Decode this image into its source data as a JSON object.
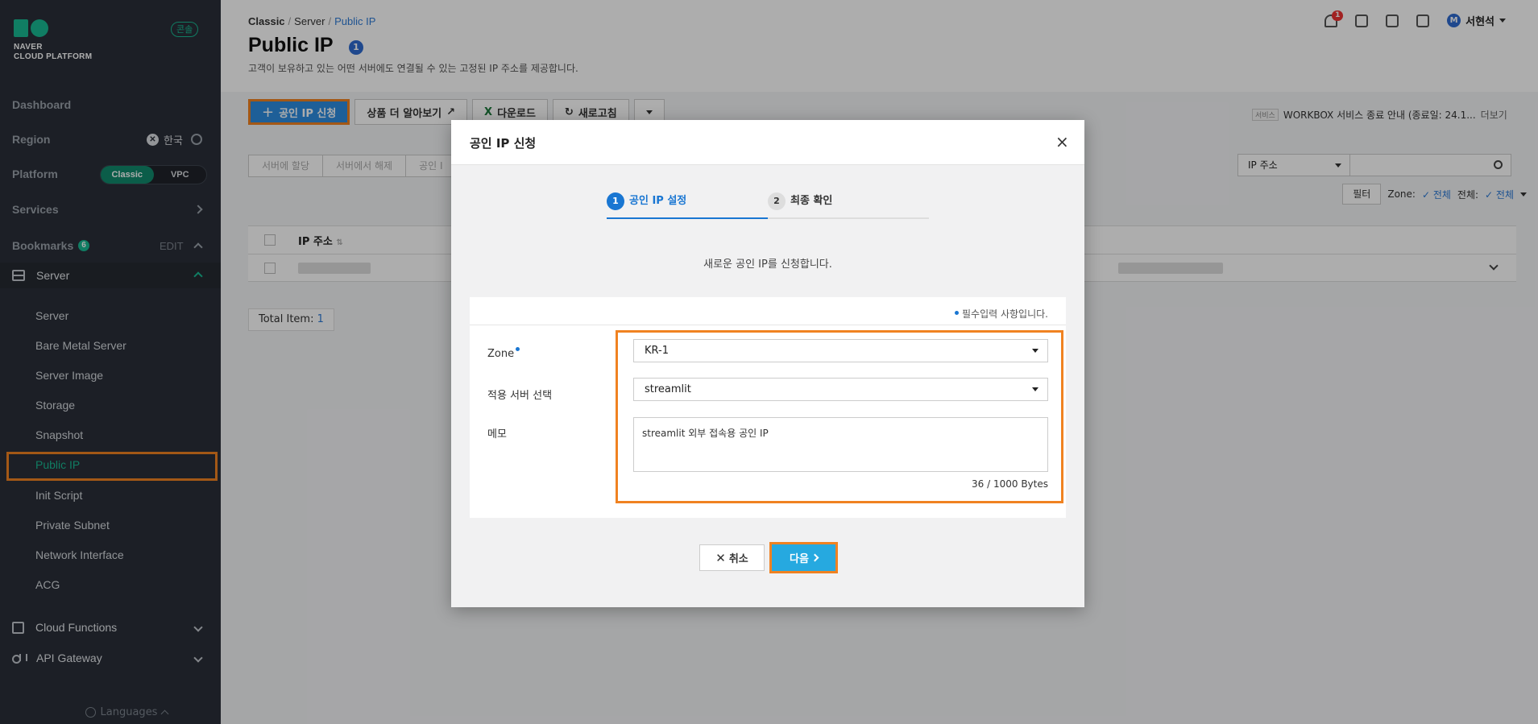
{
  "sidebar": {
    "logo_line1": "NAVER",
    "logo_line2": "CLOUD PLATFORM",
    "console_badge": "콘솔",
    "dashboard": "Dashboard",
    "region_label": "Region",
    "region_value": "한국",
    "platform_label": "Platform",
    "platform_options": [
      "Classic",
      "VPC"
    ],
    "platform_selected": "Classic",
    "services_label": "Services",
    "bookmarks_label": "Bookmarks",
    "bookmarks_count": "6",
    "bookmarks_edit": "EDIT",
    "server_group": "Server",
    "server_items": [
      "Server",
      "Bare Metal Server",
      "Server Image",
      "Storage",
      "Snapshot",
      "Public IP",
      "Init Script",
      "Private Subnet",
      "Network Interface",
      "ACG"
    ],
    "active_item": "Public IP",
    "cloud_functions": "Cloud Functions",
    "api_gateway": "API Gateway",
    "languages": "Languages"
  },
  "header": {
    "breadcrumb": [
      "Classic",
      "Server",
      "Public IP"
    ],
    "title": "Public IP",
    "title_count": "1",
    "description": "고객이 보유하고 있는 어떤 서버에도 연결될 수 있는 고정된 IP 주소를 제공합니다.",
    "notification_count": "1",
    "user_initial": "M",
    "user_name": "서현석"
  },
  "toolbar": {
    "apply_ip": "공인 IP 신청",
    "learn_more": "상품 더 알아보기",
    "download": "다운로드",
    "refresh": "새로고침"
  },
  "notice": {
    "tag": "서비스",
    "text": "WORKBOX 서비스 종료 안내 (종료일: 24.1...",
    "more": "더보기"
  },
  "filters": {
    "tabs": [
      "서버에 할당",
      "서버에서 해제",
      "공인 I"
    ],
    "search_select": "IP 주소",
    "filter_btn": "필터",
    "zone_label": "Zone:",
    "zone_value": "전체",
    "all_label": "전체:",
    "all_value": "전체"
  },
  "table": {
    "column_ip": "IP 주소",
    "total_label": "Total Item:",
    "total_count": "1"
  },
  "modal": {
    "title": "공인 IP 신청",
    "steps": [
      {
        "num": "1",
        "label": "공인 IP 설정"
      },
      {
        "num": "2",
        "label": "최종 확인"
      }
    ],
    "subtitle": "새로운 공인 IP를 신청합니다.",
    "required_note": "필수입력 사항입니다.",
    "zone_label": "Zone",
    "zone_value": "KR-1",
    "server_label": "적용 서버 선택",
    "server_value": "streamlit",
    "memo_label": "메모",
    "memo_value": "streamlit 외부 접속용 공인 IP",
    "byte_count": "36 / 1000 Bytes",
    "cancel": "취소",
    "next": "다음"
  },
  "colors": {
    "brand": "#19b892",
    "highlight": "#f08221",
    "primary_blue": "#1976d2",
    "next_button": "#26a9e0"
  }
}
